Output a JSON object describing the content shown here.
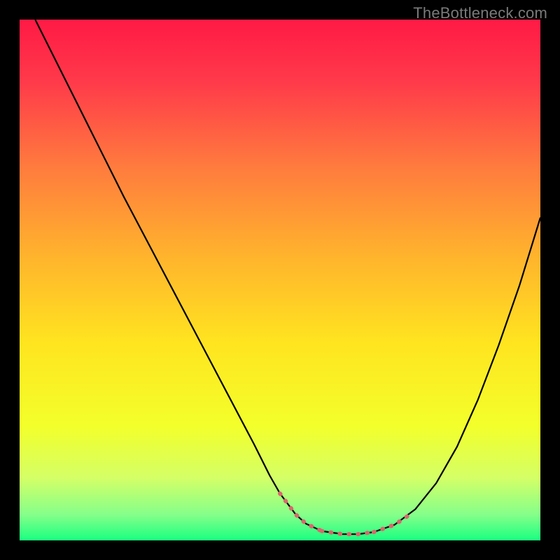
{
  "watermark": "TheBottleneck.com",
  "colors": {
    "curve": "#000000",
    "dotted": "#d9676e",
    "frame": "#000000",
    "gradient_stops": [
      {
        "offset": 0,
        "color": "#ff1a45"
      },
      {
        "offset": 12,
        "color": "#ff3a4a"
      },
      {
        "offset": 28,
        "color": "#ff7a3e"
      },
      {
        "offset": 45,
        "color": "#ffb22d"
      },
      {
        "offset": 62,
        "color": "#ffe420"
      },
      {
        "offset": 78,
        "color": "#f3ff2a"
      },
      {
        "offset": 88,
        "color": "#d4ff66"
      },
      {
        "offset": 95,
        "color": "#86ff8a"
      },
      {
        "offset": 100,
        "color": "#1aff80"
      }
    ]
  },
  "chart_data": {
    "type": "line",
    "title": "",
    "xlabel": "",
    "ylabel": "",
    "xlim": [
      0,
      100
    ],
    "ylim": [
      0,
      100
    ],
    "series": [
      {
        "name": "curve",
        "style": "solid-black",
        "x": [
          3,
          6,
          10,
          15,
          20,
          25,
          30,
          35,
          40,
          45,
          48,
          50,
          53,
          55,
          58,
          62,
          65,
          68,
          72,
          76,
          80,
          84,
          88,
          92,
          96,
          100
        ],
        "y": [
          100,
          94,
          86,
          76,
          66,
          56.5,
          47,
          37.5,
          28,
          18.5,
          12.5,
          9,
          5,
          3.2,
          1.8,
          1.2,
          1.2,
          1.6,
          3,
          6,
          11,
          18,
          27,
          37.5,
          49,
          62
        ]
      },
      {
        "name": "optimal-zone-highlight",
        "style": "dotted-red",
        "x": [
          50,
          53,
          55,
          58,
          62,
          65,
          68,
          72,
          75
        ],
        "y": [
          9,
          5,
          3.2,
          1.8,
          1.2,
          1.2,
          1.6,
          3,
          5
        ]
      }
    ],
    "annotations": []
  }
}
